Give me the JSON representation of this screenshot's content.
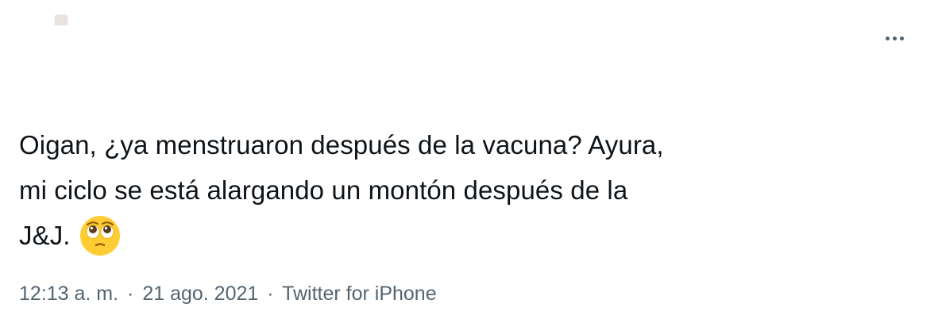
{
  "tweet": {
    "text_lines": [
      "Oigan, ¿ya menstruaron después de la vacuna? Ayura,",
      "mi ciclo se está alargando un montón después de la",
      "J&J."
    ],
    "emoji": "face-holding-back-tears-icon",
    "time": "12:13 a. m.",
    "date": "21 ago. 2021",
    "separator": "·",
    "source": "Twitter for iPhone"
  },
  "colors": {
    "text": "#0f1419",
    "secondary": "#536471",
    "emoji_face": "#ffcc33"
  },
  "icons": {
    "more": "more-horizontal-icon",
    "avatar": "avatar"
  }
}
